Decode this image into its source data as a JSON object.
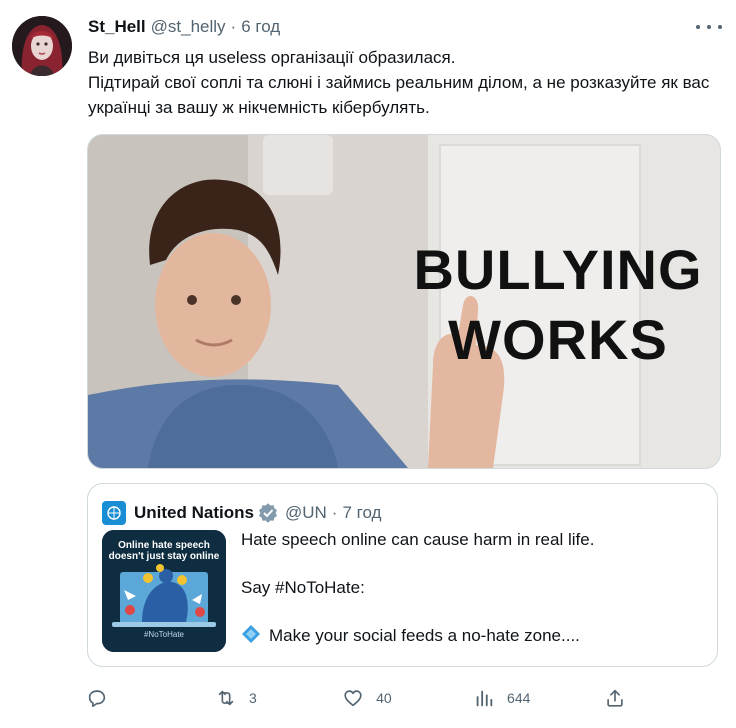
{
  "author": {
    "name": "St_Hell",
    "handle": "@st_helly",
    "separator": "·",
    "time": "6 год"
  },
  "tweet_text": [
    "Ви дивіться ця useless організації образилася.",
    "Підтирай свої соплі та слюні і займись реальним ділом, а не розказуйте як вас українці за вашу ж нікчемність кібербулять."
  ],
  "media": {
    "caption_line1": "BULLYING",
    "caption_line2": "WORKS"
  },
  "quoted": {
    "name": "United Nations",
    "handle": "@UN",
    "separator": "·",
    "time": "7 год",
    "thumb_title_1": "Online hate speech",
    "thumb_title_2": "doesn't just stay online",
    "thumb_tag": "#NoToHate",
    "text_line1": "Hate speech online can cause harm in real life.",
    "text_line2": "Say #NoToHate:",
    "text_line3": "Make your social feeds a no-hate zone...."
  },
  "actions": {
    "reply_count": "",
    "retweet_count": "3",
    "like_count": "40",
    "views_count": "644"
  },
  "colors": {
    "text": "#0f1419",
    "secondary": "#536471",
    "border": "#cfd9de",
    "verified": "#829aab",
    "un_blue": "#1a8ed4"
  }
}
